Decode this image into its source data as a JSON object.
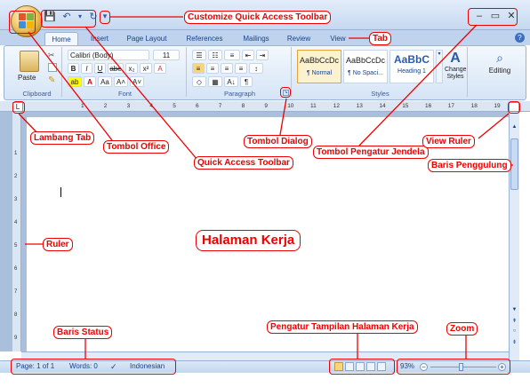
{
  "qat": {
    "save": "💾",
    "undo": "↶",
    "undo_arrow": "▾",
    "redo": "↻",
    "customize": "▾"
  },
  "window": {
    "min": "–",
    "max": "▭",
    "close": "✕",
    "help": "?"
  },
  "tabs": [
    "Home",
    "Insert",
    "Page Layout",
    "References",
    "Mailings",
    "Review",
    "View"
  ],
  "ribbon": {
    "clipboard": {
      "paste": "Paste",
      "label": "Clipboard"
    },
    "font": {
      "name": "Calibri (Body)",
      "size": "11",
      "bold": "B",
      "italic": "I",
      "underline": "U",
      "strike": "abe",
      "sub": "x₂",
      "sup": "x²",
      "clear": "A",
      "grow": "A˄",
      "shrink": "A˅",
      "case": "Aa",
      "label": "Font"
    },
    "paragraph": {
      "sort": "A↓",
      "pilcrow": "¶",
      "label": "Paragraph"
    },
    "styles": {
      "items": [
        {
          "preview": "AaBbCcDc",
          "name": "¶ Normal"
        },
        {
          "preview": "AaBbCcDc",
          "name": "¶ No Spaci..."
        },
        {
          "preview": "AaBbC",
          "name": "Heading 1"
        }
      ],
      "change": "Change Styles",
      "label": "Styles"
    },
    "editing": {
      "label": "Editing"
    }
  },
  "ruler": {
    "numbers": [
      "1",
      "2",
      "3",
      "4",
      "5",
      "6",
      "7",
      "8",
      "9",
      "10",
      "11",
      "12",
      "13",
      "14",
      "15",
      "16",
      "17",
      "18",
      "19"
    ]
  },
  "vruler": {
    "numbers": [
      "1",
      "2",
      "3",
      "4",
      "5",
      "6",
      "7",
      "8",
      "9"
    ]
  },
  "status": {
    "page": "Page: 1 of 1",
    "words": "Words: 0",
    "language": "Indonesian",
    "zoom": "93%",
    "zoom_level": 0.93
  },
  "callouts": {
    "customize_qat": "Customize Quick Access Toolbar",
    "tab": "Tab",
    "lambang_tab": "Lambang Tab",
    "tombol_office": "Tombol Office",
    "tombol_dialog": "Tombol Dialog",
    "qat": "Quick Access Toolbar",
    "tombol_jendela": "Tombol Pengatur Jendela",
    "view_ruler": "View Ruler",
    "baris_penggulung": "Baris Penggulung",
    "ruler": "Ruler",
    "halaman_kerja": "Halaman Kerja",
    "baris_status": "Baris Status",
    "pengatur_tampilan": "Pengatur Tampilan Halaman Kerja",
    "zoom": "Zoom"
  },
  "colors": {
    "callout": "#ee0000",
    "ribbon": "#d5e4f6",
    "title": "#c6d8f0"
  }
}
